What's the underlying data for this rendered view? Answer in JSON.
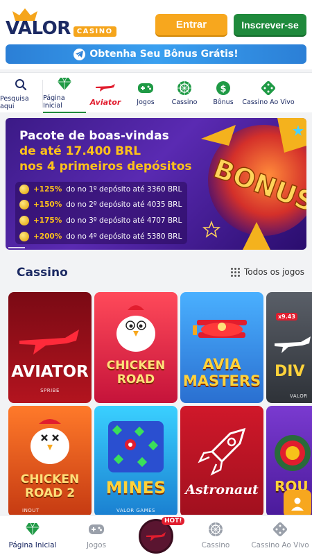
{
  "header": {
    "logo_text": "VALOR",
    "logo_badge": "CASINO",
    "login_label": "Entrar",
    "signup_label": "Inscrever-se"
  },
  "bonus_bar": {
    "text": "Obtenha Seu Bônus Grátis!",
    "icon": "telegram-icon"
  },
  "nav": [
    {
      "label": "Pesquisa aqui",
      "icon": "search-icon"
    },
    {
      "label": "Página Inicial",
      "icon": "diamond-icon",
      "active": true
    },
    {
      "label": "Aviator",
      "icon": "plane-icon"
    },
    {
      "label": "Jogos",
      "icon": "gamepad-icon"
    },
    {
      "label": "Cassino",
      "icon": "roulette-icon"
    },
    {
      "label": "Bônus",
      "icon": "dollar-icon"
    },
    {
      "label": "Cassino Ao Vivo",
      "icon": "dice-icon"
    }
  ],
  "banner": {
    "title": "Pacote de boas-vindas",
    "line2": "de até 17.400 BRL",
    "line3": "nos 4 primeiros depósitos",
    "art_text": "BONUS",
    "deposits": [
      {
        "pct": "+125%",
        "text": "do no 1º depósito até 3360 BRL"
      },
      {
        "pct": "+150%",
        "text": "do no 2º depósito até 4035 BRL"
      },
      {
        "pct": "+175%",
        "text": "do no 3º depósito até 4707 BRL"
      },
      {
        "pct": "+200%",
        "text": "do no 4º depósito até 5380 BRL"
      }
    ]
  },
  "section": {
    "title": "Cassino",
    "all_label": "Todos os jogos"
  },
  "games": [
    {
      "title": "AVIATOR",
      "provider": "SPRIBE"
    },
    {
      "title": "CHICKEN ROAD",
      "provider": ""
    },
    {
      "title": "AVIA MASTERS",
      "provider": ""
    },
    {
      "title": "DIV",
      "provider": "VALOR",
      "badge": "x9.43"
    },
    {
      "title": "CHICKEN ROAD 2",
      "provider": "INOUT"
    },
    {
      "title": "MINES",
      "provider": "VALOR GAMES"
    },
    {
      "title": "Astronaut",
      "provider": ""
    },
    {
      "title": "ROU",
      "provider": ""
    }
  ],
  "bottom_nav": [
    {
      "label": "Página Inicial",
      "icon": "diamond-icon",
      "active": true
    },
    {
      "label": "Jogos",
      "icon": "gamepad-icon"
    },
    {
      "label": "",
      "icon": "aviator-plane-icon",
      "badge": "HOT!"
    },
    {
      "label": "Cassino",
      "icon": "roulette-icon"
    },
    {
      "label": "Cassino Ao Vivo",
      "icon": "dice-icon"
    }
  ],
  "colors": {
    "navy": "#1c2a63",
    "orange": "#f7a71e",
    "green": "#1f8a3c",
    "blue": "#2b7fd6"
  }
}
